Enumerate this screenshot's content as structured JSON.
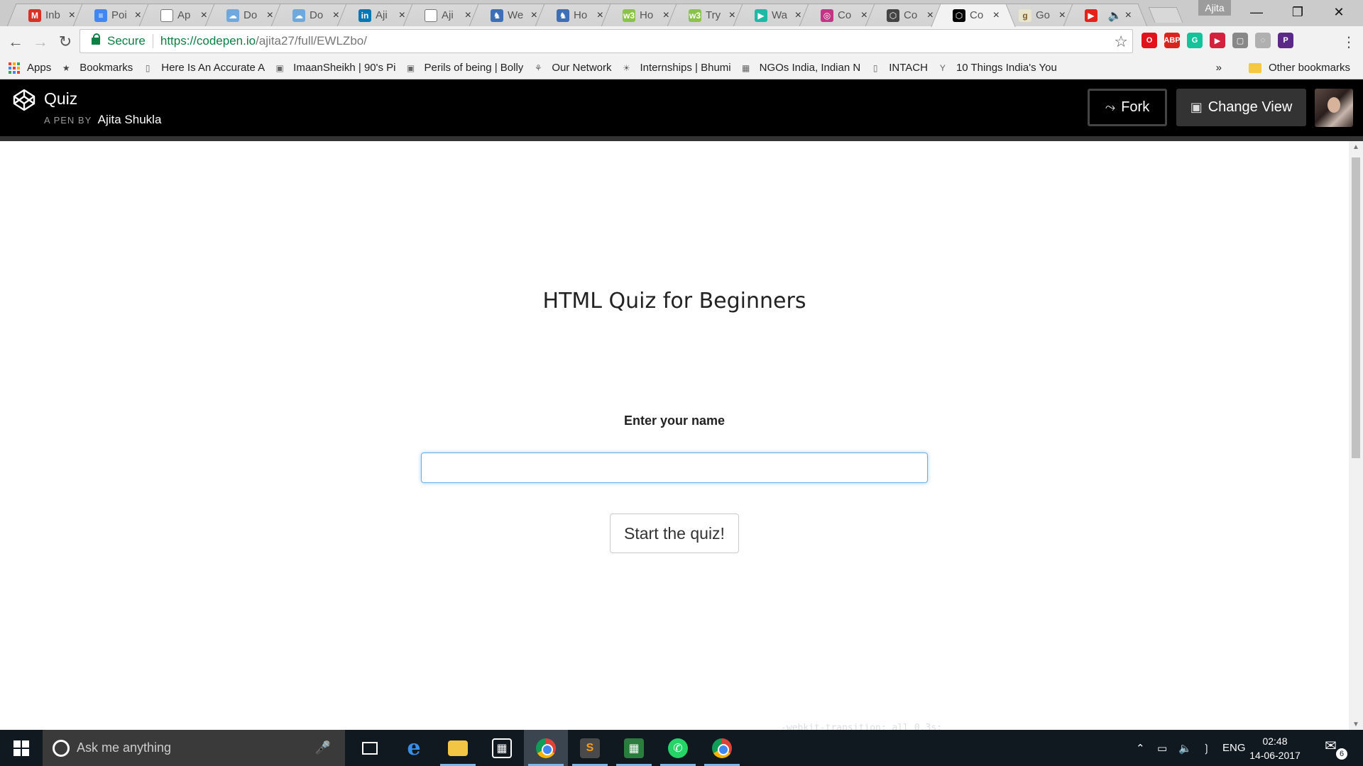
{
  "browser": {
    "profile_name": "Ajita",
    "tabs": [
      {
        "title": "Inb",
        "icon": "gmail-icon",
        "color": "#d93025",
        "glyph": "M"
      },
      {
        "title": "Poi",
        "icon": "docs-icon",
        "color": "#4285f4",
        "glyph": "≡"
      },
      {
        "title": "Ap",
        "icon": "page-icon",
        "color": "#ffffff",
        "glyph": ""
      },
      {
        "title": "Do",
        "icon": "cloud-icon",
        "color": "#6fa8dc",
        "glyph": "☁"
      },
      {
        "title": "Do",
        "icon": "cloud-icon",
        "color": "#6fa8dc",
        "glyph": "☁"
      },
      {
        "title": "Aji",
        "icon": "linkedin-icon",
        "color": "#0077b5",
        "glyph": "in"
      },
      {
        "title": "Aji",
        "icon": "page-icon",
        "color": "#ffffff",
        "glyph": ""
      },
      {
        "title": "We",
        "icon": "figure-icon",
        "color": "#3d6fb6",
        "glyph": "♞"
      },
      {
        "title": "Ho",
        "icon": "figure-icon",
        "color": "#3d6fb6",
        "glyph": "♞"
      },
      {
        "title": "Ho",
        "icon": "w3-icon",
        "color": "#8bc34a",
        "glyph": "w3"
      },
      {
        "title": "Try",
        "icon": "w3-icon",
        "color": "#8bc34a",
        "glyph": "w3"
      },
      {
        "title": "Wa",
        "icon": "play-icon",
        "color": "#1db9a4",
        "glyph": "▶"
      },
      {
        "title": "Co",
        "icon": "instagram-icon",
        "color": "#c13584",
        "glyph": "◎"
      },
      {
        "title": "Co",
        "icon": "codepen-icon",
        "color": "#444444",
        "glyph": "⬡"
      },
      {
        "title": "Co",
        "icon": "codepen-icon",
        "color": "#000000",
        "glyph": "⬡",
        "active": true
      },
      {
        "title": "Go",
        "icon": "goodreads-icon",
        "color": "#e9e5cd",
        "glyph": "g"
      },
      {
        "title": "",
        "icon": "youtube-icon",
        "color": "#e62117",
        "glyph": "▶",
        "audio": "🔈"
      }
    ],
    "url": {
      "secure_label": "Secure",
      "scheme_host": "https://codepen.io",
      "path": "/ajita27/full/EWLZbo/"
    },
    "extensions": [
      {
        "name": "opera-icon",
        "color": "#e0121b",
        "glyph": "O"
      },
      {
        "name": "adblock-icon",
        "color": "#d9241c",
        "glyph": "ABP"
      },
      {
        "name": "grammarly-icon",
        "color": "#15c39a",
        "glyph": "G"
      },
      {
        "name": "pocket-icon",
        "color": "#d4213d",
        "glyph": "▶"
      },
      {
        "name": "extension-icon",
        "color": "#888888",
        "glyph": "▢"
      },
      {
        "name": "extension-icon",
        "color": "#b0b0b0",
        "glyph": "◌"
      },
      {
        "name": "p-extension-icon",
        "color": "#5b2a86",
        "glyph": "P"
      }
    ],
    "bookmarks": [
      {
        "label": "Apps",
        "icon": "apps-icon"
      },
      {
        "label": "Bookmarks",
        "icon": "star-icon"
      },
      {
        "label": "Here Is An Accurate A",
        "icon": "page-icon"
      },
      {
        "label": "ImaanSheikh | 90's Pi",
        "icon": "photo-icon"
      },
      {
        "label": "Perils of being | Bolly",
        "icon": "photo-icon"
      },
      {
        "label": "Our Network",
        "icon": "network-icon"
      },
      {
        "label": "Internships | Bhumi",
        "icon": "bhumi-icon"
      },
      {
        "label": "NGOs India, Indian N",
        "icon": "grid-icon"
      },
      {
        "label": "INTACH",
        "icon": "page-icon"
      },
      {
        "label": "10 Things India's You",
        "icon": "y-icon"
      }
    ],
    "overflow_label": "»",
    "other_bookmarks_label": "Other bookmarks"
  },
  "codepen": {
    "pen_title": "Quiz",
    "byline_prefix": "A PEN BY",
    "author": "Ajita Shukla",
    "fork_label": "Fork",
    "change_view_label": "Change View"
  },
  "quiz": {
    "title": "HTML Quiz for Beginners",
    "name_label": "Enter your name",
    "name_value": "",
    "start_label": "Start the quiz!"
  },
  "taskbar": {
    "search_placeholder": "Ask me anything",
    "language": "ENG",
    "time": "02:48",
    "date": "14-06-2017",
    "notification_count": "6",
    "background_code": "-webkit-transition: all 0.3s;"
  }
}
